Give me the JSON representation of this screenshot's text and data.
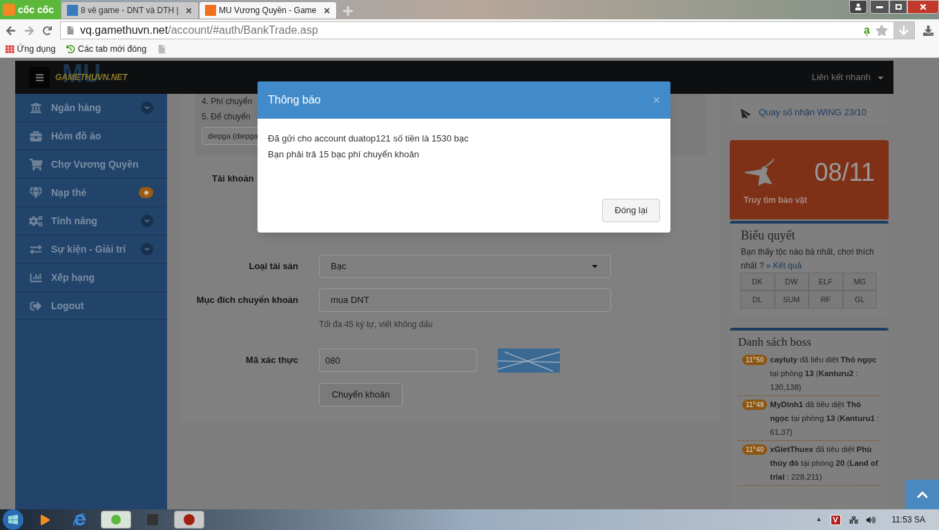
{
  "browser": {
    "brand": "cốc cốc",
    "tabs": [
      {
        "title": "8 vê game - DNT và DTH |",
        "selected": false
      },
      {
        "title": "MU Vương Quyền - Game",
        "selected": true
      }
    ],
    "address": {
      "host": "vq.gamethuvn.net",
      "path": "/account/#auth/BankTrade.asp"
    },
    "address_glyph": "ạ",
    "bookmarks": [
      "Ứng dụng",
      "Các tab mới đóng"
    ]
  },
  "navbar": {
    "logo_big": "MU",
    "logo": "GAMETHUVN.NET",
    "quick_links": "Liên kết nhanh"
  },
  "sidebar": {
    "items": [
      {
        "label": "Ngân hàng",
        "kind": "submenu"
      },
      {
        "label": "Hòm đồ ảo",
        "kind": "plain"
      },
      {
        "label": "Chợ Vương Quyền",
        "kind": "plain"
      },
      {
        "label": "Nạp thẻ",
        "kind": "featured"
      },
      {
        "label": "Tính năng",
        "kind": "submenu"
      },
      {
        "label": "Sự kiện - Giải trí",
        "kind": "submenu"
      },
      {
        "label": "Xếp hạng",
        "kind": "plain"
      },
      {
        "label": "Logout",
        "kind": "plain"
      }
    ]
  },
  "notes": [
    "4. Phí chuyển",
    "5. Để chuyển"
  ],
  "notes_select": "diepga (diepga",
  "form": {
    "account_label": "Tài khoản",
    "asset": {
      "label": "Loại tài sản",
      "value": "Bạc"
    },
    "purpose": {
      "label": "Mục đích chuyển khoản",
      "value": "mua DNT",
      "hint": "Tối đa 45 ký tự, viết không dấu"
    },
    "captcha": {
      "label": "Mã xác thực",
      "value": "080"
    },
    "submit": "Chuyển khoản"
  },
  "right": {
    "link": "Quay số nhận WING 23/10",
    "event": {
      "date": "08/11",
      "title": "Truy tìm bảo vật"
    },
    "vote": {
      "title": "Biểu quyết",
      "question": "Bạn thấy tộc nào bá nhất, chơi thích nhất ?",
      "result_link": "» Kết quả",
      "options": [
        "DK",
        "DW",
        "ELF",
        "MG",
        "DL",
        "SUM",
        "RF",
        "GL"
      ]
    },
    "boss": {
      "title": "Danh sách boss",
      "entries": [
        {
          "time": "11$^{h}$50",
          "text": "**cayluty** đã tiêu diệt **Thỏ ngọc** tại phòng **13** (**Kanturu2** : 130,138)"
        },
        {
          "time": "11$^{h}$49",
          "text": "**MyDinh1** đã tiêu diệt **Thỏ ngọc** tại phòng **13** (**Kanturu1** : 61,37)"
        },
        {
          "time": "11$^{h}$40",
          "text": "**xGietThuex** đã tiêu diệt **Phù thủy đỏ** tại phòng **20** (**Land of trial** : 228,211)"
        }
      ]
    }
  },
  "modal": {
    "title": "Thông báo",
    "close": "×",
    "lines": [
      "Đã gửi cho account duatop121 số tiền là 1530 bạc",
      "Bạn phải trả 15 bạc phí chuyển khoản"
    ],
    "button": "Đóng lại"
  },
  "taskbar": {
    "tray_arrow": "▲",
    "tray_badge": "V",
    "clock": "11:53 SA"
  }
}
